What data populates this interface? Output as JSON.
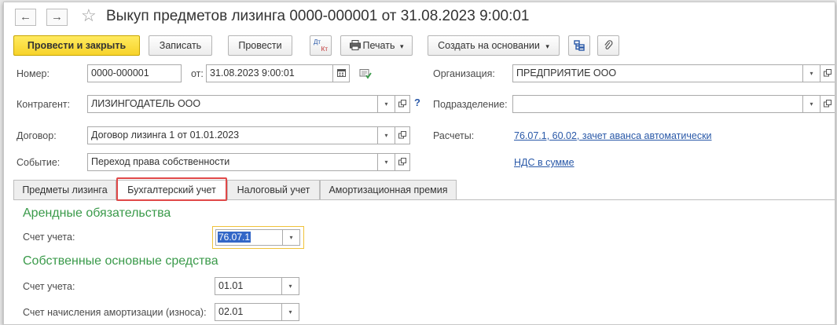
{
  "window": {
    "title": "Выкуп предметов лизинга 0000-000001 от 31.08.2023 9:00:01"
  },
  "nav": {
    "back_icon": "←",
    "forward_icon": "→",
    "star_icon": "☆"
  },
  "toolbar": {
    "post_and_close": "Провести и закрыть",
    "save": "Записать",
    "post": "Провести",
    "dt_kt_top": "Дт",
    "dt_kt_bottom": "Кт",
    "print": "Печать",
    "print_arrow": "▾",
    "create_based_on": "Создать на основании",
    "create_arrow": "▾"
  },
  "form": {
    "number_label": "Номер:",
    "number_value": "0000-000001",
    "date_label": "от:",
    "date_value": "31.08.2023  9:00:01",
    "organization_label": "Организация:",
    "organization_value": "ПРЕДПРИЯТИЕ ООО",
    "counterparty_label": "Контрагент:",
    "counterparty_value": "ЛИЗИНГОДАТЕЛЬ ООО",
    "help_mark": "?",
    "department_label": "Подразделение:",
    "department_value": "",
    "contract_label": "Договор:",
    "contract_value": "Договор лизинга 1 от 01.01.2023",
    "settlements_label": "Расчеты:",
    "settlements_link": "76.07.1, 60.02, зачет аванса автоматически",
    "event_label": "Событие:",
    "event_value": "Переход права собственности",
    "vat_link": "НДС в сумме"
  },
  "tabs": [
    {
      "label": "Предметы лизинга"
    },
    {
      "label": "Бухгалтерский учет"
    },
    {
      "label": "Налоговый учет"
    },
    {
      "label": "Амортизационная премия"
    }
  ],
  "accounting": {
    "lease_section": "Арендные обязательства",
    "lease_account_label": "Счет учета:",
    "lease_account_value": "76.07.1",
    "fixed_assets_section": "Собственные основные средства",
    "fa_account_label": "Счет учета:",
    "fa_account_value": "01.01",
    "depreciation_label": "Счет начисления амортизации (износа):",
    "depreciation_value": "02.01"
  },
  "dropdown_arrow": "▾",
  "colors": {
    "primary_button": "#f7d32a",
    "section_heading": "#3a9a4a",
    "link": "#2a59a8",
    "highlight_box": "#e04848",
    "focus_border": "#f0c23a",
    "selected_text_bg": "#3367c7"
  }
}
